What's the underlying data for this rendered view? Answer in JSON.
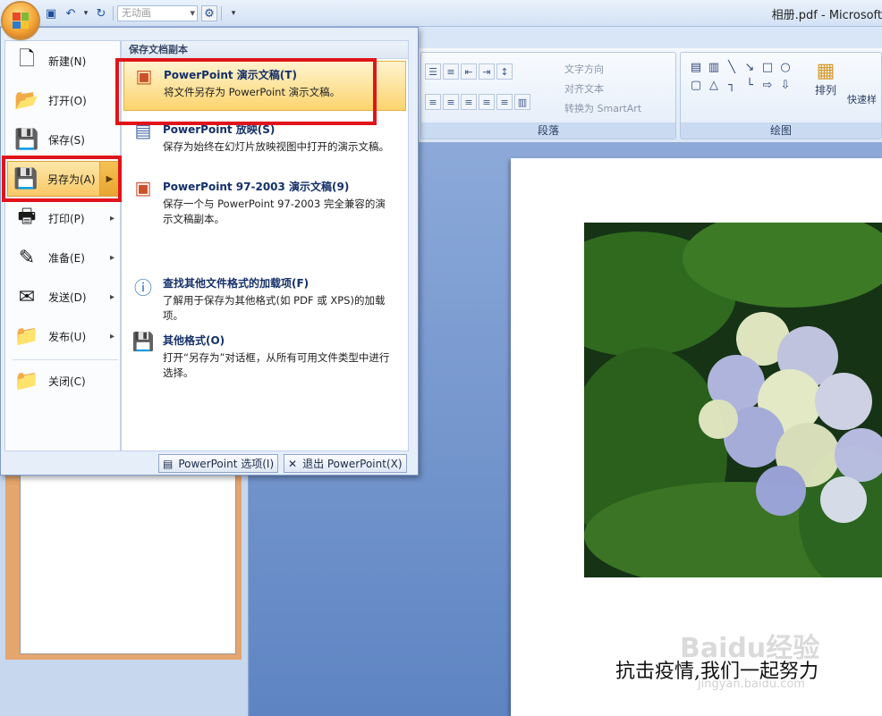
{
  "titlebar": {
    "title": "相册.pdf - Microsoft",
    "combo_value": "无动画",
    "qat_icons": [
      "save-icon",
      "undo-icon",
      "redo-icon",
      "slideshow-icon",
      "customize-icon"
    ]
  },
  "ribbon": {
    "paragraph_label": "段落",
    "drawing_label": "绘图",
    "text_direction": "文字方向",
    "align_text": "对齐文本",
    "convert_smartart": "转换为 SmartArt",
    "arrange": "排列",
    "quick_styles": "快速样"
  },
  "office_menu": {
    "left_items": [
      {
        "label": "新建(N)",
        "icon": "new-document-icon",
        "has_submenu": false
      },
      {
        "label": "打开(O)",
        "icon": "open-folder-icon",
        "has_submenu": false
      },
      {
        "label": "保存(S)",
        "icon": "save-icon",
        "has_submenu": false
      },
      {
        "label": "另存为(A)",
        "icon": "save-as-icon",
        "has_submenu": true,
        "active": true
      },
      {
        "label": "打印(P)",
        "icon": "print-icon",
        "has_submenu": true
      },
      {
        "label": "准备(E)",
        "icon": "prepare-icon",
        "has_submenu": true
      },
      {
        "label": "发送(D)",
        "icon": "send-icon",
        "has_submenu": true
      },
      {
        "label": "发布(U)",
        "icon": "publish-icon",
        "has_submenu": true
      },
      {
        "label": "关闭(C)",
        "icon": "close-folder-icon",
        "has_submenu": false
      }
    ],
    "right_header": "保存文档副本",
    "right_items": [
      {
        "title": "PowerPoint 演示文稿(T)",
        "desc": "将文件另存为 PowerPoint 演示文稿。",
        "icon": "pptx-icon"
      },
      {
        "title": "PowerPoint 放映(S)",
        "desc": "保存为始终在幻灯片放映视图中打开的演示文稿。",
        "icon": "ppsx-icon"
      },
      {
        "title": "PowerPoint 97-2003 演示文稿(9)",
        "desc": "保存一个与 PowerPoint 97-2003 完全兼容的演示文稿副本。",
        "icon": "ppt-legacy-icon"
      },
      {
        "title": "查找其他文件格式的加载项(F)",
        "desc": "了解用于保存为其他格式(如 PDF 或 XPS)的加载项。",
        "icon": "addin-info-icon"
      },
      {
        "title": "其他格式(O)",
        "desc": "打开“另存为”对话框，从所有可用文件类型中进行选择。",
        "icon": "other-formats-icon"
      }
    ],
    "options_button": "PowerPoint 选项(I)",
    "exit_button": "退出 PowerPoint(X)"
  },
  "slide": {
    "caption": "抗击疫情,我们一起努力",
    "watermark": "Baidu经验",
    "watermark_url": "jingyan.baidu.com"
  },
  "colors": {
    "highlight_box": "#e0141a",
    "menu_active": "#f9c867"
  }
}
